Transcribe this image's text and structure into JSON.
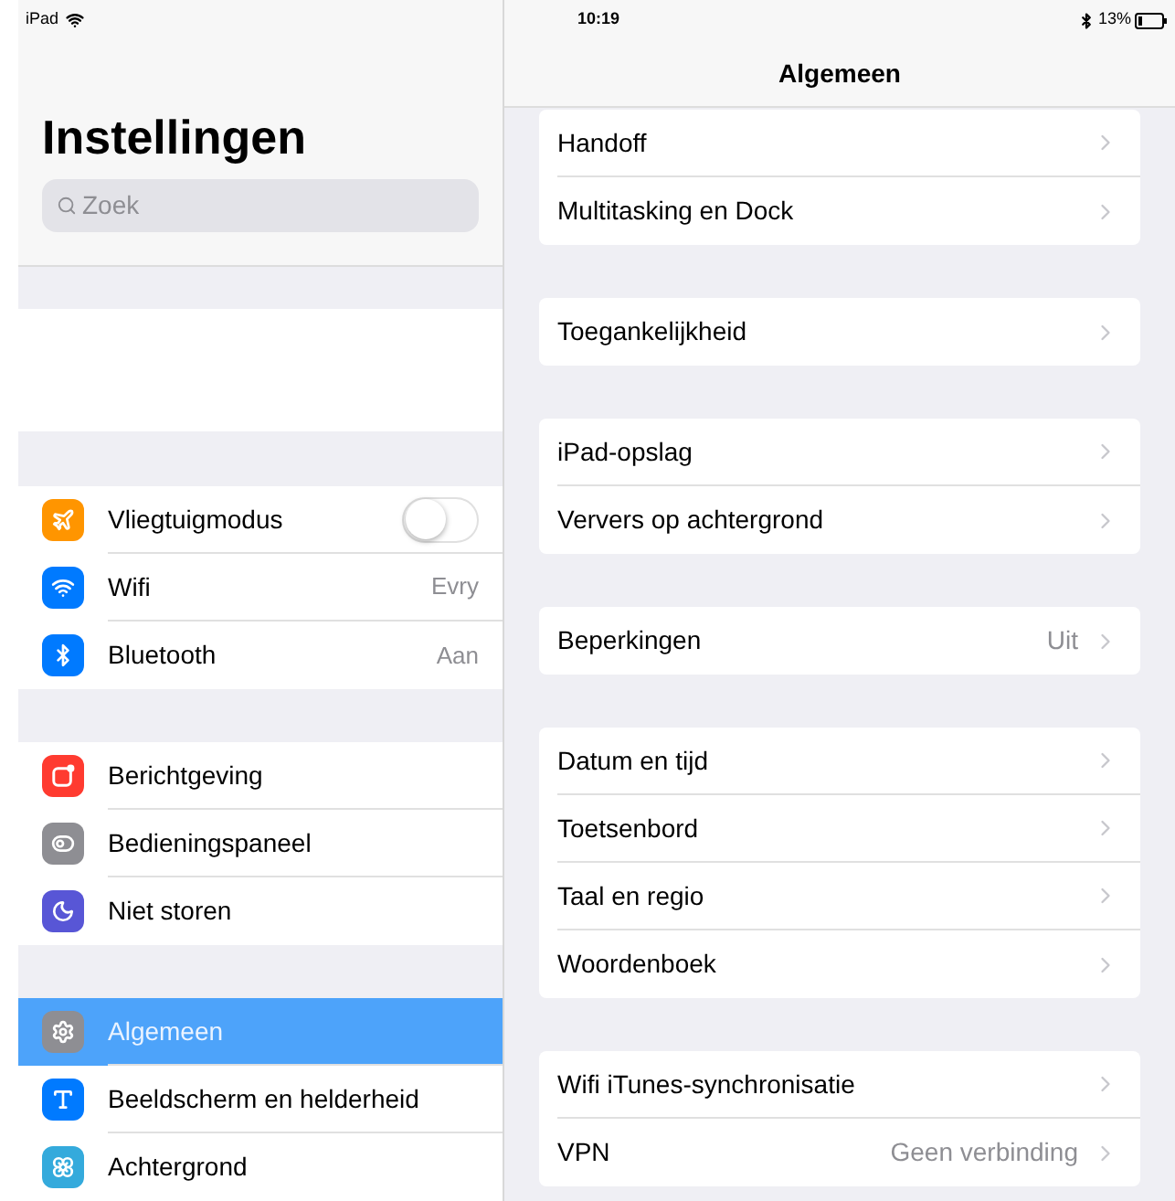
{
  "status_bar": {
    "device": "iPad",
    "time": "10:19",
    "battery": "13%"
  },
  "sidebar": {
    "title": "Instellingen",
    "search": {
      "placeholder": "Zoek"
    },
    "groups": [
      [
        {
          "label": "Vliegtuigmodus",
          "color": "#ff9500",
          "kind": "toggle",
          "on": false,
          "selected": false
        },
        {
          "label": "Wifi",
          "color": "#007aff",
          "kind": "value",
          "value": "Evry",
          "selected": false
        },
        {
          "label": "Bluetooth",
          "color": "#007aff",
          "kind": "value",
          "value": "Aan",
          "selected": false
        }
      ],
      [
        {
          "label": "Berichtgeving",
          "color": "#ff3b30",
          "kind": "plain",
          "selected": false
        },
        {
          "label": "Bedieningspaneel",
          "color": "#8e8e93",
          "kind": "plain",
          "selected": false
        },
        {
          "label": "Niet storen",
          "color": "#5856d6",
          "kind": "plain",
          "selected": false
        }
      ],
      [
        {
          "label": "Algemeen",
          "color": "#8e8e93",
          "kind": "plain",
          "selected": true
        },
        {
          "label": "Beeldscherm en helderheid",
          "color": "#007aff",
          "kind": "plain",
          "selected": false
        },
        {
          "label": "Achtergrond",
          "color": "#34aadc",
          "kind": "plain",
          "selected": false
        }
      ]
    ]
  },
  "detail": {
    "title": "Algemeen",
    "groups": [
      [
        {
          "label": "Handoff"
        },
        {
          "label": "Multitasking en Dock"
        }
      ],
      [
        {
          "label": "Toegankelijkheid"
        }
      ],
      [
        {
          "label": "iPad-opslag"
        },
        {
          "label": "Ververs op achtergrond"
        }
      ],
      [
        {
          "label": "Beperkingen",
          "value": "Uit"
        }
      ],
      [
        {
          "label": "Datum en tijd"
        },
        {
          "label": "Toetsenbord"
        },
        {
          "label": "Taal en regio"
        },
        {
          "label": "Woordenboek"
        }
      ],
      [
        {
          "label": "Wifi iTunes-synchronisatie"
        },
        {
          "label": "VPN",
          "value": "Geen verbinding"
        }
      ]
    ]
  }
}
